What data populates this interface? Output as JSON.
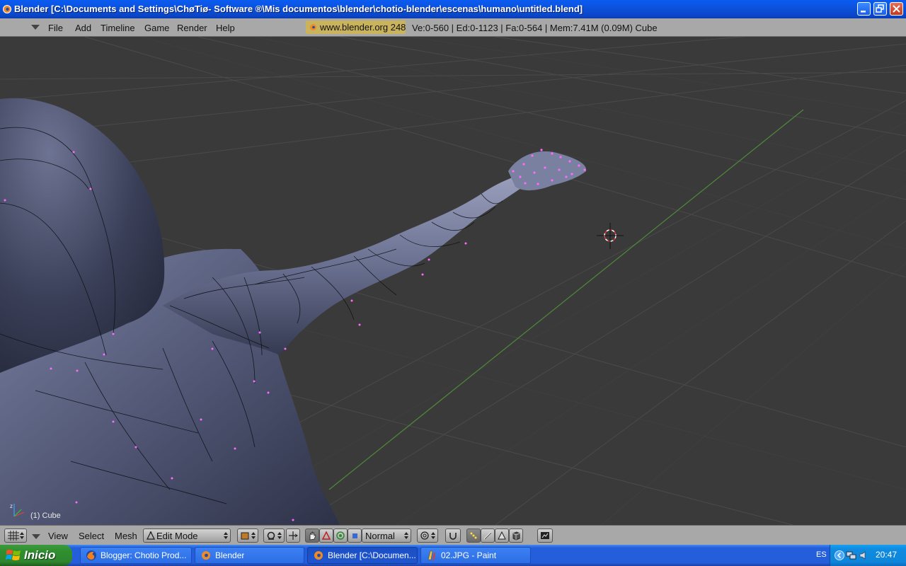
{
  "window": {
    "title": "Blender [C:\\Documents and Settings\\ChøTiø- Software ®\\Mis documentos\\blender\\chotio-blender\\escenas\\humano\\untitled.blend]"
  },
  "menubar": {
    "items": [
      "File",
      "Add",
      "Timeline",
      "Game",
      "Render",
      "Help"
    ],
    "version_box": "www.blender.org 248",
    "stats": "Ve:0-560 | Ed:0-1123 | Fa:0-564 | Mem:7.41M (0.09M) Cube"
  },
  "viewport": {
    "object_label": "(1) Cube",
    "background_color": "#3a3a3a",
    "grid_color": "#4a4a4a",
    "mesh_color": "#5a607a",
    "vertex_color": "#ff6aff"
  },
  "view_header": {
    "menus": [
      "View",
      "Select",
      "Mesh"
    ],
    "mode": "Edit Mode",
    "shading": "Normal"
  },
  "taskbar": {
    "start_label": "Inicio",
    "tasks": [
      {
        "label": "Blogger: Chotio Prod...",
        "icon": "firefox-icon"
      },
      {
        "label": "Blender",
        "icon": "blender-icon"
      },
      {
        "label": "Blender [C:\\Documen...",
        "icon": "blender-icon"
      },
      {
        "label": "02.JPG - Paint",
        "icon": "paint-icon"
      }
    ],
    "language": "ES",
    "clock": "20:47"
  }
}
